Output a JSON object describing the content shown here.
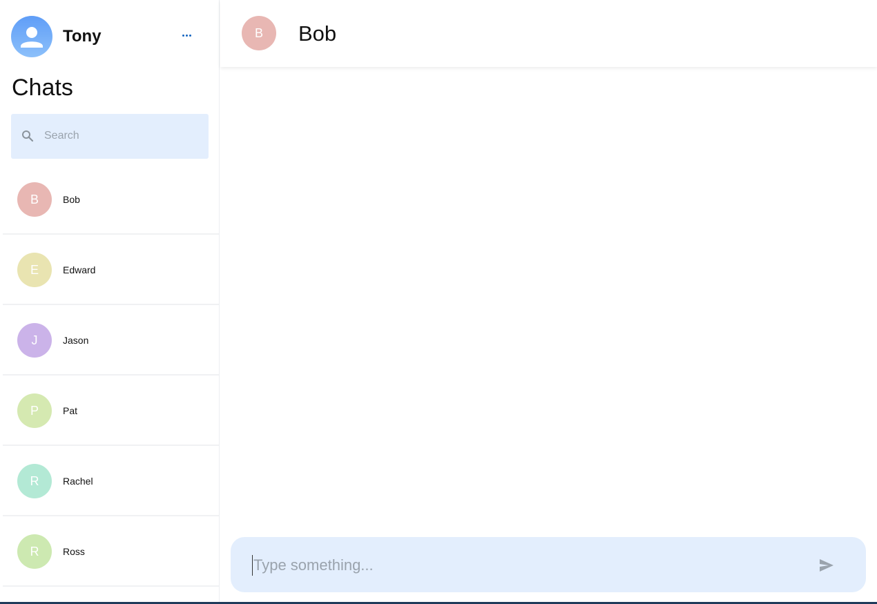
{
  "user": {
    "name": "Tony",
    "avatar_icon": "user-person-icon",
    "avatar_color": "#6aa6f8"
  },
  "sidebar": {
    "title": "Chats",
    "more_icon": "more-horizontal-icon",
    "search": {
      "placeholder": "Search",
      "value": ""
    }
  },
  "chats": [
    {
      "initial": "B",
      "name": "Bob",
      "color": "#e8b7b3"
    },
    {
      "initial": "E",
      "name": "Edward",
      "color": "#e9e4b1"
    },
    {
      "initial": "J",
      "name": "Jason",
      "color": "#cbb3e9"
    },
    {
      "initial": "P",
      "name": "Pat",
      "color": "#d5e9b1"
    },
    {
      "initial": "R",
      "name": "Rachel",
      "color": "#b3e9d5"
    },
    {
      "initial": "R",
      "name": "Ross",
      "color": "#cde9b1"
    }
  ],
  "active_chat": {
    "initial": "B",
    "name": "Bob",
    "color": "#e8b7b3"
  },
  "composer": {
    "placeholder": "Type something...",
    "value": "",
    "send_icon": "send-icon"
  }
}
